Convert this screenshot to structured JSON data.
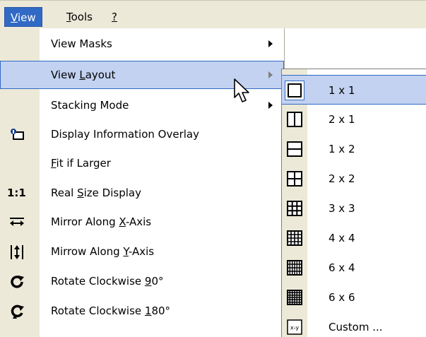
{
  "menubar": {
    "items": [
      {
        "label": "View",
        "mnemonic_index": 0,
        "active": true
      },
      {
        "label": "Tools",
        "mnemonic_index": 0,
        "active": false
      },
      {
        "label": "?",
        "mnemonic_index": 0,
        "active": false
      }
    ]
  },
  "menu": {
    "items": [
      {
        "label": "View Masks",
        "icon": "",
        "submenu": true
      },
      {
        "label": "View Layout",
        "mnemonic": "L",
        "icon": "",
        "submenu": true,
        "highlighted": true
      },
      {
        "label": "Stacking Mode",
        "icon": "",
        "submenu": true
      },
      {
        "label": "Display Information Overlay",
        "icon": "info-overlay-icon",
        "submenu": false
      },
      {
        "label": "Fit if Larger",
        "mnemonic": "F",
        "icon": "",
        "submenu": false
      },
      {
        "label": "Real Size Display",
        "mnemonic": "S",
        "icon": "real-size-icon",
        "icon_text": "1:1",
        "submenu": false
      },
      {
        "label": "Mirror Along X-Axis",
        "mnemonic": "X",
        "icon": "mirror-horizontal-icon",
        "submenu": false
      },
      {
        "label": "Mirrow Along Y-Axis",
        "mnemonic": "Y",
        "icon": "mirror-vertical-icon",
        "submenu": false
      },
      {
        "label": "Rotate Clockwise 90°",
        "mnemonic": "9",
        "icon": "rotate-90-icon",
        "submenu": false
      },
      {
        "label": "Rotate Clockwise 180°",
        "mnemonic": "1",
        "icon": "rotate-180-icon",
        "submenu": false
      }
    ]
  },
  "submenu": {
    "items": [
      {
        "label": "1 x 1",
        "icon": "grid-1x1-icon",
        "selected": true
      },
      {
        "label": "2 x 1",
        "icon": "grid-2x1-icon"
      },
      {
        "label": "1 x 2",
        "icon": "grid-1x2-icon"
      },
      {
        "label": "2 x 2",
        "icon": "grid-2x2-icon"
      },
      {
        "label": "3 x 3",
        "icon": "grid-3x3-icon"
      },
      {
        "label": "4 x 4",
        "icon": "grid-4x4-icon"
      },
      {
        "label": "6 x 4",
        "icon": "grid-6x4-icon"
      },
      {
        "label": "6 x 6",
        "icon": "grid-6x6-icon"
      },
      {
        "label": "Custom ...",
        "icon": "custom-grid-icon",
        "icon_text": "x-y"
      }
    ]
  },
  "colors": {
    "menubar_bg": "#ece9d8",
    "highlight_bg": "#c2d2f0",
    "highlight_border": "#316ac5",
    "active_menu_bg": "#316ac5"
  }
}
